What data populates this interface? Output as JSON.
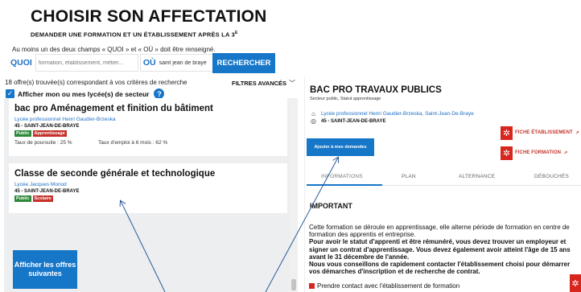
{
  "header": {
    "title": "CHOISIR SON AFFECTATION",
    "subtitle": "DEMANDER UNE FORMATION ET UN ÉTABLISSEMENT APRÈS LA 3",
    "subtitle_sup": "E"
  },
  "search": {
    "required_note": "Au moins un des deux champs « QUOI » et « OÙ » doit être renseigné.",
    "quoi_label": "QUOI",
    "quoi_placeholder": "formation, établissement, métier...",
    "ou_label": "OÙ",
    "ou_value": "saint jean de braye",
    "button_label": "RECHERCHER"
  },
  "results": {
    "count_text": "18 offre(s) trouvée(s) correspondant à vos critères de recherche",
    "filters_label": "FILTRES AVANCÉS",
    "filter_checkbox_label": "Afficher mon ou mes lycée(s) de secteur",
    "help_icon_text": "?",
    "offers": [
      {
        "title": "bac pro Aménagement et finition du bâtiment",
        "school": "Lycée professionnel Henri Gaudier-Brzeska",
        "location": "45 - SAINT-JEAN-DE-BRAYE",
        "badges": [
          "Public",
          "Apprentissage"
        ],
        "rate_poursuite": "Taux de poursuite : 25 %",
        "rate_emploi": "Taux d'emploi à 6 mois : 62 %"
      },
      {
        "title": "Classe de seconde générale et technologique",
        "school": "Lycée Jacques Monod",
        "location": "45 - SAINT-JEAN-DE-BRAYE",
        "badges": [
          "Public",
          "Scolaire"
        ]
      }
    ],
    "more_button": "Afficher les offres suivantes"
  },
  "detail": {
    "title": "BAC PRO TRAVAUX PUBLICS",
    "sector": "Secteur public, Statut apprentissage",
    "school": "Lycée professionnel Henri Gaudier-Brzeska, Saint-Jean-De-Braye",
    "location": "45 - SAINT-JEAN-DE-BRAYE",
    "add_button": "Ajouter à mes demandes",
    "link_etablissement": "FICHE ÉTABLISSEMENT",
    "link_formation": "FICHE FORMATION",
    "tabs": [
      "INFORMATIONS",
      "PLAN",
      "ALTERNANCE",
      "DÉBOUCHÉS"
    ],
    "active_tab": 0,
    "important_heading": "IMPORTANT",
    "para1": "Cette formation se déroule en apprentissage, elle alterne période de formation en centre de formation des apprentis et entreprise.",
    "para2": "Pour avoir le statut d'apprenti et être rémunéré, vous devez trouver un employeur et signer un contrat d'apprentissage. Vous devez également avoir atteint l'âge de 15 ans avant le 31 décembre de l'année.",
    "para3": "Nous vous conseillons de rapidement contacter l'établissement choisi pour démarrer vos démarches d'inscription et de recherche de contrat.",
    "contact_link": "Prendre contact avec l'établissement de formation"
  },
  "colors": {
    "primary_blue": "#1676c8",
    "link_blue": "#1f6fc4",
    "badge_green": "#2e8a3a",
    "badge_red": "#c4322a",
    "brand_red": "#d7261e"
  }
}
